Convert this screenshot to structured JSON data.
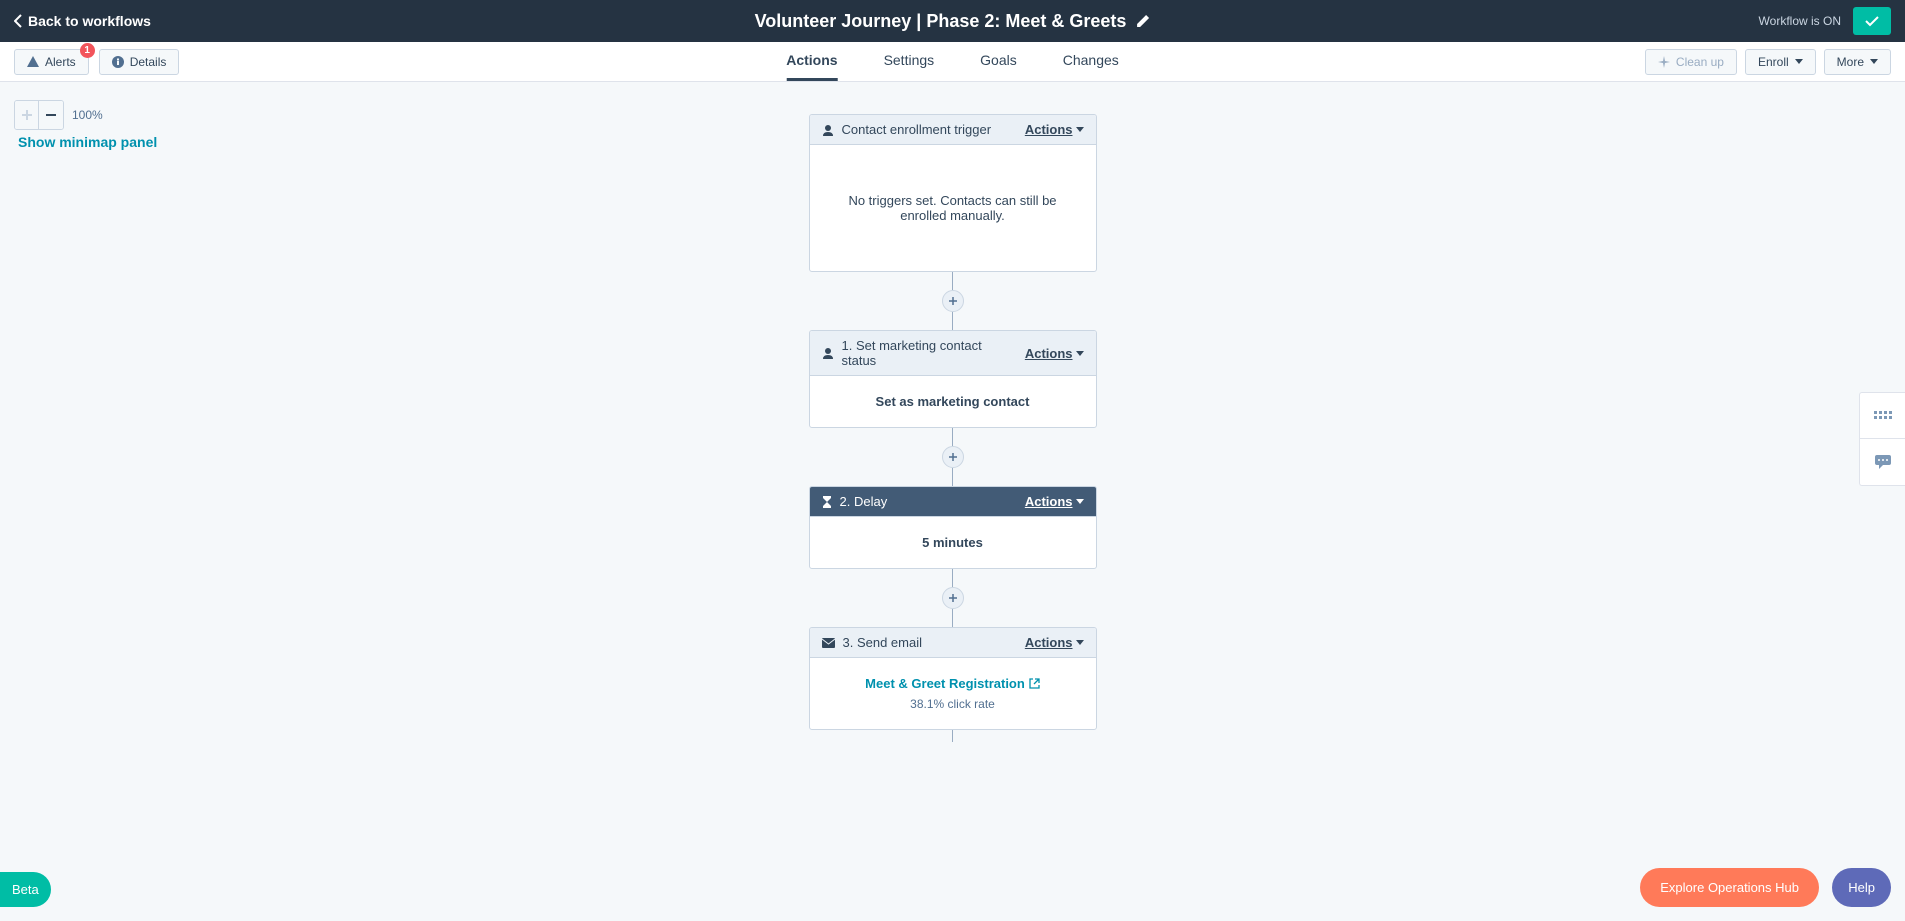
{
  "header": {
    "back_label": "Back to workflows",
    "title": "Volunteer Journey | Phase 2: Meet & Greets",
    "status": "Workflow is ON"
  },
  "subheader": {
    "alerts_label": "Alerts",
    "alerts_badge": "1",
    "details_label": "Details",
    "tabs": [
      {
        "label": "Actions",
        "active": true
      },
      {
        "label": "Settings",
        "active": false
      },
      {
        "label": "Goals",
        "active": false
      },
      {
        "label": "Changes",
        "active": false
      }
    ],
    "cleanup_label": "Clean up",
    "enroll_label": "Enroll",
    "more_label": "More"
  },
  "zoom": {
    "level": "100%",
    "minimap_label": "Show minimap panel"
  },
  "cards": {
    "trigger": {
      "title": "Contact enrollment trigger",
      "actions": "Actions",
      "body": "No triggers set. Contacts can still be enrolled manually."
    },
    "step1": {
      "title": "1. Set marketing contact status",
      "actions": "Actions",
      "body": "Set as marketing contact"
    },
    "step2": {
      "title": "2. Delay",
      "actions": "Actions",
      "body": "5 minutes"
    },
    "step3": {
      "title": "3. Send email",
      "actions": "Actions",
      "link": "Meet & Greet Registration",
      "rate": "38.1% click rate"
    }
  },
  "bottom": {
    "beta": "Beta",
    "explore": "Explore Operations Hub",
    "help": "Help"
  }
}
